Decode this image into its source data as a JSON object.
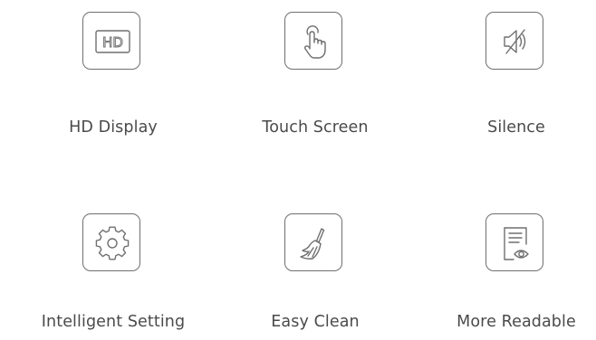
{
  "features": [
    {
      "label": "HD Display",
      "icon": "hd-icon",
      "badge": "HD"
    },
    {
      "label": "Touch Screen",
      "icon": "touch-hand-icon"
    },
    {
      "label": "Silence",
      "icon": "mute-speaker-icon"
    },
    {
      "label": "Intelligent Setting",
      "icon": "gear-icon"
    },
    {
      "label": "Easy Clean",
      "icon": "broom-icon"
    },
    {
      "label": "More Readable",
      "icon": "document-eye-icon"
    }
  ],
  "colors": {
    "icon_stroke": "#6f6f6f",
    "label_text": "#4a4a4a",
    "background": "#ffffff"
  }
}
